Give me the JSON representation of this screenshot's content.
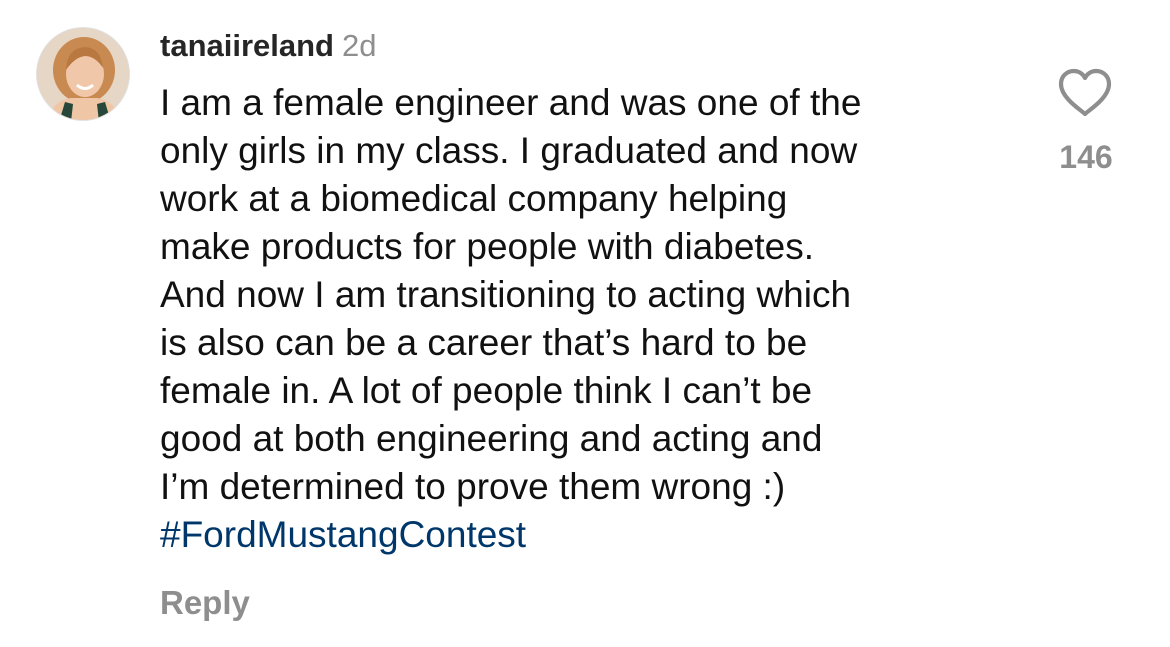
{
  "comment": {
    "username": "tanaiireland",
    "time": "2d",
    "lines": [
      "I am a female engineer and was one of the",
      "only girls in my class. I graduated and now",
      "work at a biomedical company helping",
      "make products for people with diabetes.",
      "And now I am transitioning to acting which",
      "is also can be a career that’s hard to be",
      "female in. A lot of people think I can’t be",
      "good at both engineering and acting and",
      "I’m determined to prove them wrong :)"
    ],
    "hashtag": "#FordMustangContest",
    "reply_label": "Reply",
    "like_count": "146"
  },
  "colors": {
    "username": "#262626",
    "secondary": "#8e8e8e",
    "hashtag": "#00376b",
    "text": "#111111"
  },
  "icons": {
    "avatar": "profile-photo",
    "like": "heart-outline-icon"
  }
}
